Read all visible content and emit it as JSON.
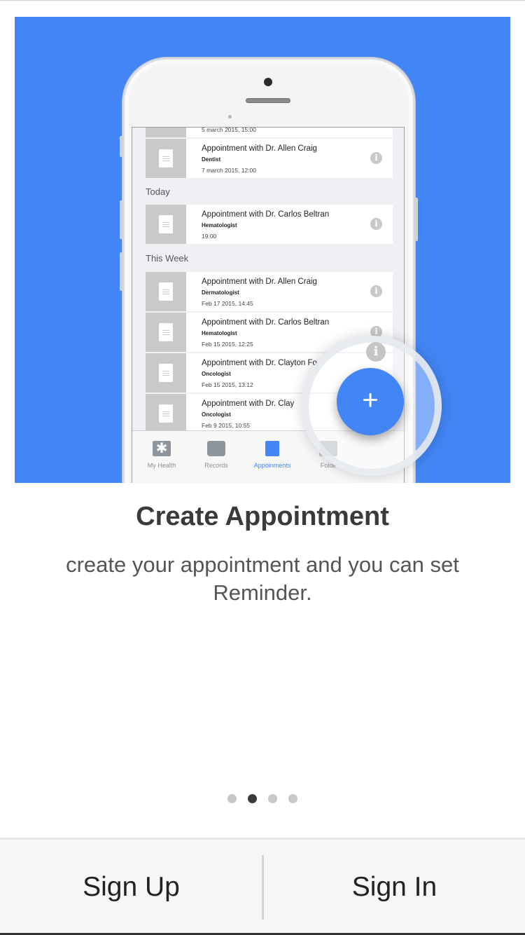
{
  "hero": {
    "appointments_top": [
      {
        "title": "Appointment with Dr. Allen Craig",
        "specialty": "Dentist",
        "time": "7 march 2015, 12:00"
      }
    ],
    "partial_time": "5 march 2015, 15:00",
    "section_today": "Today",
    "appointments_today": [
      {
        "title": "Appointment with Dr. Carlos Beltran",
        "specialty": "Hematologist",
        "time": "19:00"
      }
    ],
    "section_week": "This Week",
    "appointments_week": [
      {
        "title": "Appointment with Dr. Allen Craig",
        "specialty": "Dermatologist",
        "time": "Feb 17 2015, 14:45"
      },
      {
        "title": "Appointment with Dr. Carlos Beltran",
        "specialty": "Hematologist",
        "time": "Feb 15 2015, 12:25"
      },
      {
        "title": "Appointment with Dr. Clayton Fo",
        "specialty": "Oncologist",
        "time": "Feb 15 2015, 13:12"
      },
      {
        "title": "Appointment with Dr. Clay",
        "specialty": "Oncologist",
        "time": "Feb 9 2015, 10:55"
      }
    ],
    "tabs": [
      {
        "label": "My Health",
        "icon": "asterisk-icon"
      },
      {
        "label": "Records",
        "icon": "inbox-icon"
      },
      {
        "label": "Appoinments",
        "icon": "document-icon"
      },
      {
        "label": "Folde",
        "icon": "folder-icon"
      }
    ],
    "fab_symbol": "+",
    "info_symbol": "i",
    "colors": {
      "brand": "#4285f4"
    }
  },
  "headline": "Create Appointment",
  "subtitle": "create your appointment and you can set Reminder.",
  "pager": {
    "count": 4,
    "active_index": 1
  },
  "buttons": {
    "sign_up": "Sign Up",
    "sign_in": "Sign In"
  }
}
